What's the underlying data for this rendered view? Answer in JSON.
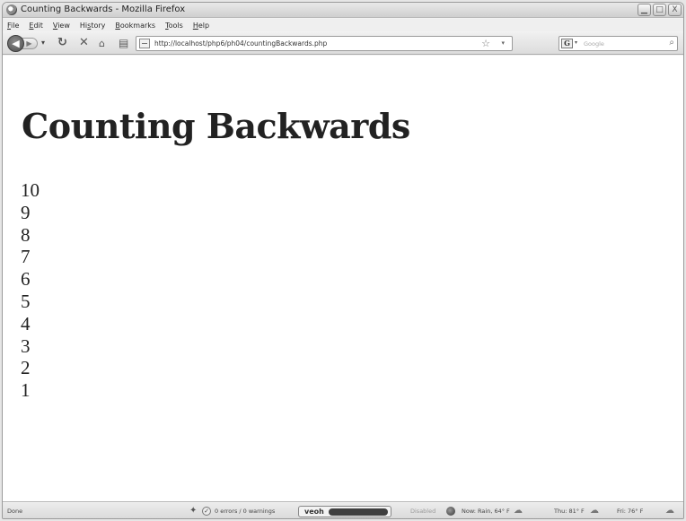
{
  "window": {
    "title": "Counting Backwards - Mozilla Firefox",
    "controls": {
      "minimize": "▁",
      "maximize": "□",
      "close": "X"
    }
  },
  "menu": {
    "items": [
      {
        "first": "F",
        "rest": "ile"
      },
      {
        "first": "E",
        "rest": "dit"
      },
      {
        "first": "V",
        "rest": "iew"
      },
      {
        "first": "",
        "rest": "Hi",
        "u": "s",
        "tail": "tory"
      },
      {
        "first": "B",
        "rest": "ookmarks"
      },
      {
        "first": "T",
        "rest": "ools"
      },
      {
        "first": "H",
        "rest": "elp"
      }
    ]
  },
  "navbar": {
    "url": "http://localhost/php6/ph04/countingBackwards.php",
    "search_placeholder": "Google",
    "search_engine_letter": "G"
  },
  "page": {
    "heading": "Counting Backwards",
    "numbers": [
      "10",
      "9",
      "8",
      "7",
      "6",
      "5",
      "4",
      "3",
      "2",
      "1"
    ]
  },
  "status": {
    "state": "Done",
    "errors": "0 errors / 0 warnings",
    "veoh": "veoh",
    "disabled": "Disabled",
    "weather_now": "Now: Rain, 64° F",
    "weather_thu": "Thu: 81° F",
    "weather_fri": "Fri: 76° F"
  }
}
